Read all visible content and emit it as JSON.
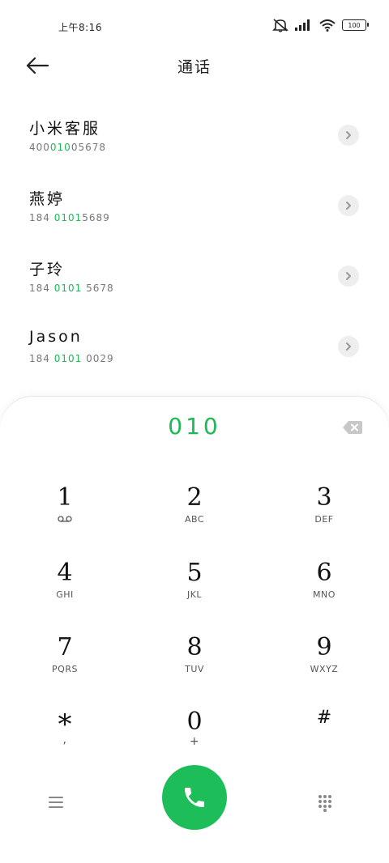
{
  "status_bar": {
    "time": "上午8:16",
    "battery": "100"
  },
  "header": {
    "title": "通话"
  },
  "contacts": [
    {
      "name": "小米客服",
      "number_pre": "400",
      "number_hl": "010",
      "number_post": "05678"
    },
    {
      "name": "燕婷",
      "number_pre": "184 ",
      "number_hl": "0101",
      "number_post": "5689"
    },
    {
      "name": "子玲",
      "number_pre": "184 ",
      "number_hl": "0101",
      "number_post": " 5678"
    },
    {
      "name": "Jason",
      "number_pre": "184 ",
      "number_hl": "0101",
      "number_post": " 0029"
    }
  ],
  "dialer": {
    "dialed": "010",
    "keys": [
      {
        "digit": "1",
        "letters": "ᴏᴏ"
      },
      {
        "digit": "2",
        "letters": "ABC"
      },
      {
        "digit": "3",
        "letters": "DEF"
      },
      {
        "digit": "4",
        "letters": "GHI"
      },
      {
        "digit": "5",
        "letters": "JKL"
      },
      {
        "digit": "6",
        "letters": "MNO"
      },
      {
        "digit": "7",
        "letters": "PQRS"
      },
      {
        "digit": "8",
        "letters": "TUV"
      },
      {
        "digit": "9",
        "letters": "WXYZ"
      },
      {
        "digit": "*",
        "letters": ","
      },
      {
        "digit": "0",
        "letters": "+"
      },
      {
        "digit": "#",
        "letters": ""
      }
    ]
  },
  "colors": {
    "accent": "#1db954",
    "call_button": "#1dbd5a"
  }
}
